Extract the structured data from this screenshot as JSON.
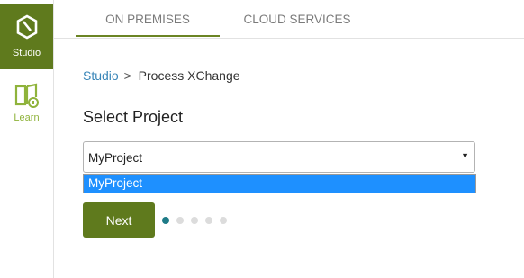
{
  "sidebar": {
    "items": [
      {
        "label": "Studio",
        "icon": "studio-hexagon-icon",
        "active": true
      },
      {
        "label": "Learn",
        "icon": "learn-book-icon",
        "active": false
      }
    ]
  },
  "tabs": [
    {
      "label": "ON PREMISES",
      "active": true
    },
    {
      "label": "CLOUD SERVICES",
      "active": false
    }
  ],
  "breadcrumb": {
    "root": "Studio",
    "separator": ">",
    "current": "Process XChange"
  },
  "page_title": "Select Project",
  "project_select": {
    "value": "MyProject",
    "options": [
      "MyProject"
    ],
    "highlighted_option": "MyProject"
  },
  "next_button": "Next",
  "progress": {
    "steps": 5,
    "current": 1
  },
  "colors": {
    "brand_green": "#5f7a1d",
    "learn_green": "#8fb33b",
    "link_blue": "#3a86b8",
    "selection_blue": "#1e90ff",
    "active_dot": "#1e7b87"
  }
}
